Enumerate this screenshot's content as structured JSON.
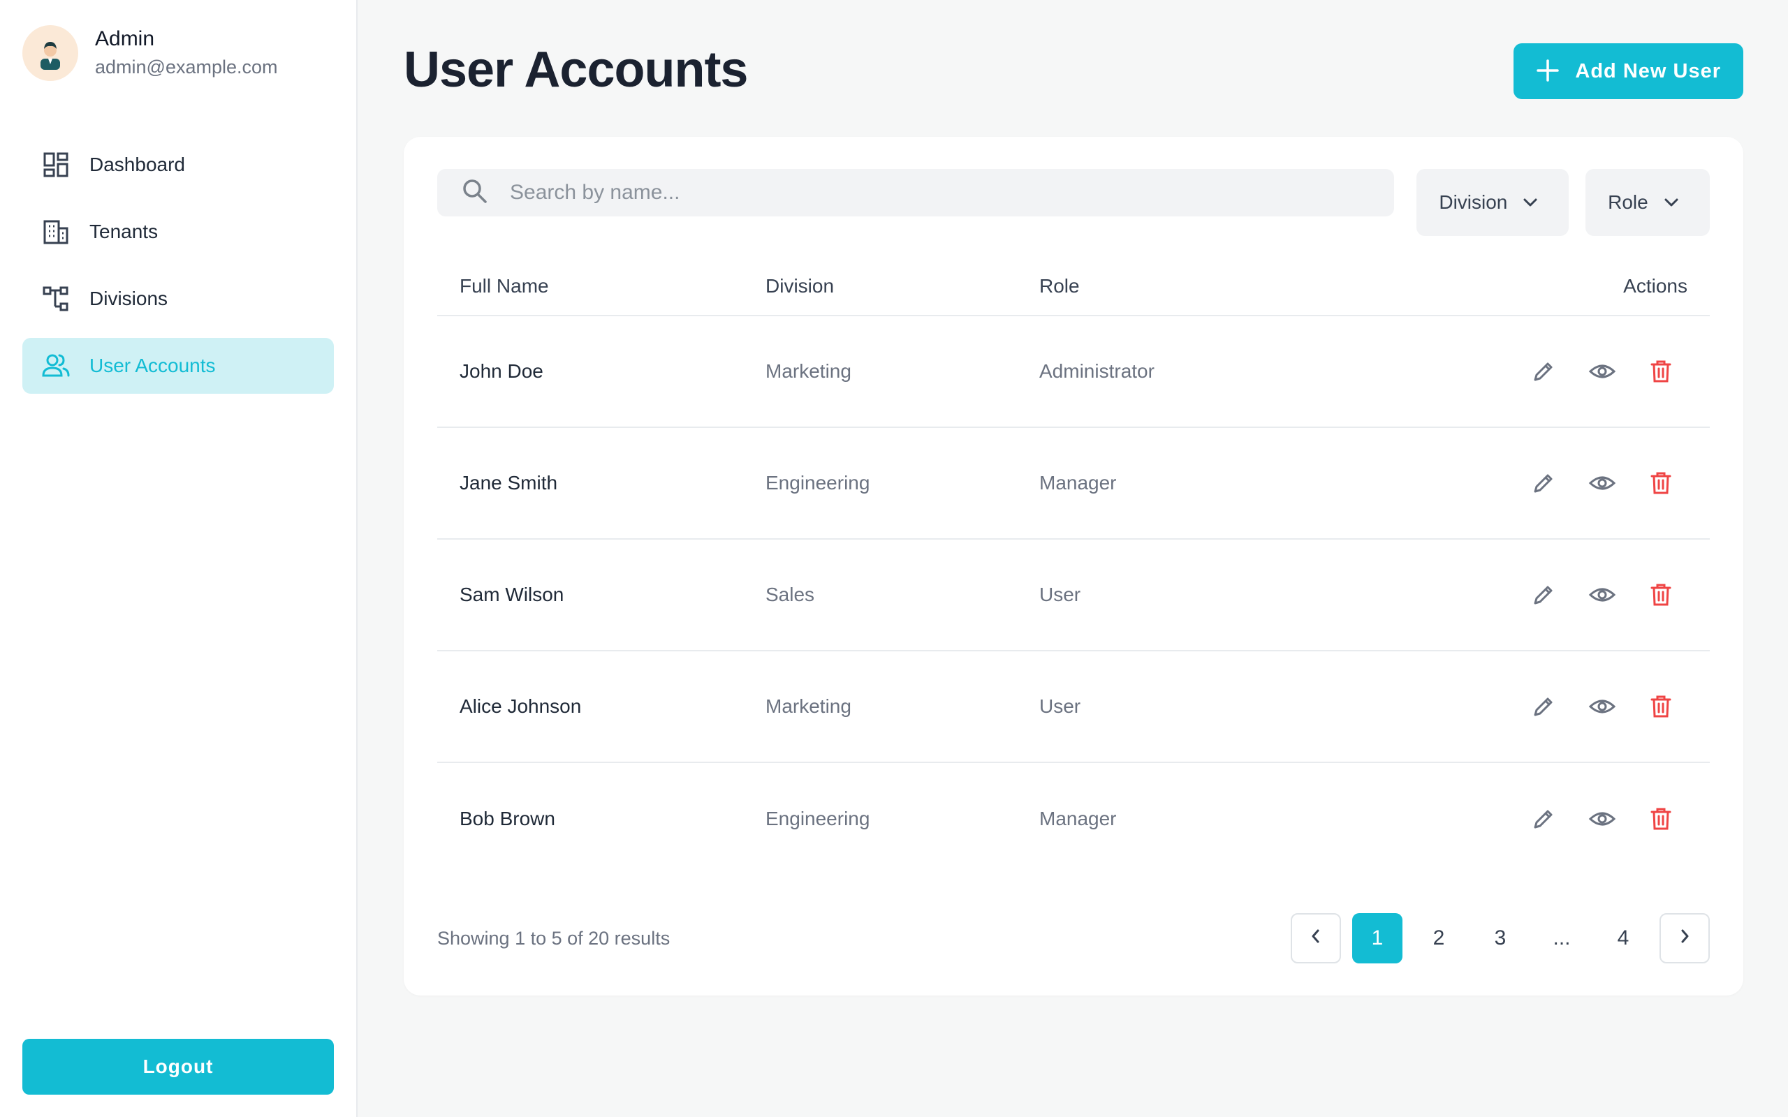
{
  "colors": {
    "accent": "#13bcd3",
    "accent_light": "#cff1f5",
    "danger": "#ef4444"
  },
  "profile": {
    "name": "Admin",
    "email": "admin@example.com"
  },
  "sidebar": {
    "items": [
      {
        "label": "Dashboard",
        "icon": "dashboard-icon"
      },
      {
        "label": "Tenants",
        "icon": "building-icon"
      },
      {
        "label": "Divisions",
        "icon": "hierarchy-icon"
      },
      {
        "label": "User Accounts",
        "icon": "users-icon",
        "active": true
      }
    ],
    "logout_label": "Logout"
  },
  "header": {
    "title": "User Accounts",
    "add_label": "Add New User"
  },
  "filters": {
    "search_placeholder": "Search by name...",
    "division_label": "Division",
    "role_label": "Role"
  },
  "table": {
    "columns": [
      "Full Name",
      "Division",
      "Role",
      "Actions"
    ],
    "rows": [
      {
        "name": "John Doe",
        "division": "Marketing",
        "role": "Administrator"
      },
      {
        "name": "Jane Smith",
        "division": "Engineering",
        "role": "Manager"
      },
      {
        "name": "Sam Wilson",
        "division": "Sales",
        "role": "User"
      },
      {
        "name": "Alice Johnson",
        "division": "Marketing",
        "role": "User"
      },
      {
        "name": "Bob Brown",
        "division": "Engineering",
        "role": "Manager"
      }
    ]
  },
  "pagination": {
    "summary": "Showing 1 to 5 of 20 results",
    "pages": [
      "1",
      "2",
      "3",
      "...",
      "4"
    ],
    "current": "1"
  }
}
